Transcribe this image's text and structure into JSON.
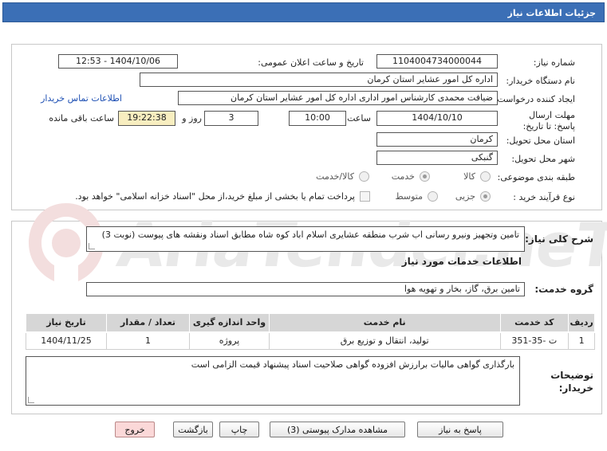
{
  "header": {
    "title": "جزئیات اطلاعات نیاز"
  },
  "fields": {
    "need_number_label": "شماره نیاز:",
    "need_number": "1104004734000044",
    "announce_label": "تاریخ و ساعت اعلان عمومی:",
    "announce_value": "1404/10/06 - 12:53",
    "buyer_org_label": "نام دستگاه خریدار:",
    "buyer_org": "اداره کل امور عشایر استان کرمان",
    "creator_label": "ایجاد کننده درخواست:",
    "creator": "ضیافت محمدی کارشناس امور اداری اداره کل امور عشایر استان کرمان",
    "contact_link": "اطلاعات تماس خریدار",
    "deadline_label": "مهلت ارسال پاسخ: تا تاریخ:",
    "deadline_date": "1404/10/10",
    "time_label": "ساعت",
    "deadline_time": "10:00",
    "days_label": "روز و",
    "days_value": "3",
    "remaining_time": "19:22:38",
    "remaining_label": "ساعت باقی مانده",
    "province_label": "استان محل تحویل:",
    "province": "کرمان",
    "city_label": "شهر محل تحویل:",
    "city": "گنبکی",
    "category_label": "طبقه بندی موضوعی:",
    "category_options": [
      "کالا",
      "خدمت",
      "کالا/خدمت"
    ],
    "category_selected": "خدمت",
    "process_label": "نوع فرآیند خرید :",
    "process_options": [
      "جزیی",
      "متوسط"
    ],
    "process_selected": "جزیی",
    "payment_note": "پرداخت تمام یا بخشی از مبلغ خرید،از محل \"اسناد خزانه اسلامی\" خواهد بود."
  },
  "summary": {
    "label": "شرح کلی نیاز:",
    "text": "تامین وتجهیز ونیرو رسانی اب شرب منطقه عشایری اسلام اباد کوه شاه مطابق اسناد ونقشه های پیوست (نوبت 3)"
  },
  "services": {
    "section_title": "اطلاعات خدمات مورد نیاز",
    "group_label": "گروه خدمت:",
    "group_value": "تامین برق، گاز، بخار و تهویه هوا",
    "columns": [
      "ردیف",
      "کد خدمت",
      "نام خدمت",
      "واحد اندازه گیری",
      "تعداد / مقدار",
      "تاریخ نیاز"
    ],
    "rows": [
      [
        "1",
        "ت -35-351",
        "تولید، انتقال و توزیع برق",
        "پروژه",
        "1",
        "1404/11/25"
      ]
    ]
  },
  "buyer_notes": {
    "label": "توضیحات خریدار:",
    "text": "بارگذاری گواهی مالیات برارزش افزوده گواهی صلاحیت اسناد پیشنهاد قیمت الزامی است"
  },
  "watermark": {
    "text": "AriaTender.neT"
  },
  "buttons": {
    "reply": "پاسخ به نیاز",
    "attachments": "مشاهده مدارک پیوستی (3)",
    "print": "چاپ",
    "back": "بازگشت",
    "exit": "خروج"
  },
  "colors": {
    "titlebar": "#3b6fb6",
    "link": "#1d4fb3",
    "remaining_bg": "#f8eec0",
    "exit_bg": "#fbd8d8"
  },
  "icons": {
    "watermark_logo": "aria-tender-logo"
  }
}
